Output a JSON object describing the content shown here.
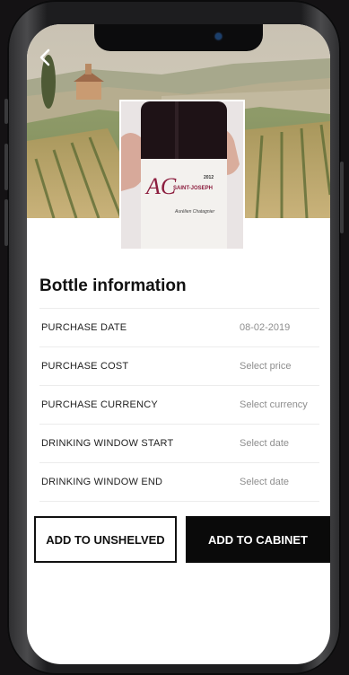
{
  "screen": {
    "back_icon": "chevron-left-icon"
  },
  "bottle": {
    "label_monogram": "AC",
    "label_line1": "2012",
    "label_line2": "SAINT-JOSEPH",
    "label_signature": "Aurélien Chatagnier"
  },
  "section": {
    "title": "Bottle information"
  },
  "info_rows": [
    {
      "label": "PURCHASE DATE",
      "value": "08-02-2019"
    },
    {
      "label": "PURCHASE COST",
      "value": "Select price"
    },
    {
      "label": "PURCHASE CURRENCY",
      "value": "Select currency"
    },
    {
      "label": "DRINKING WINDOW START",
      "value": "Select date"
    },
    {
      "label": "DRINKING WINDOW END",
      "value": "Select date"
    }
  ],
  "actions": {
    "unshelved_label": "ADD TO UNSHELVED",
    "cabinet_label": "ADD TO CABINET"
  },
  "colors": {
    "primary_button_bg": "#0a0a0a",
    "secondary_button_border": "#111111",
    "value_text": "#8e8e8e",
    "wine_label_accent": "#8c1d3e"
  }
}
